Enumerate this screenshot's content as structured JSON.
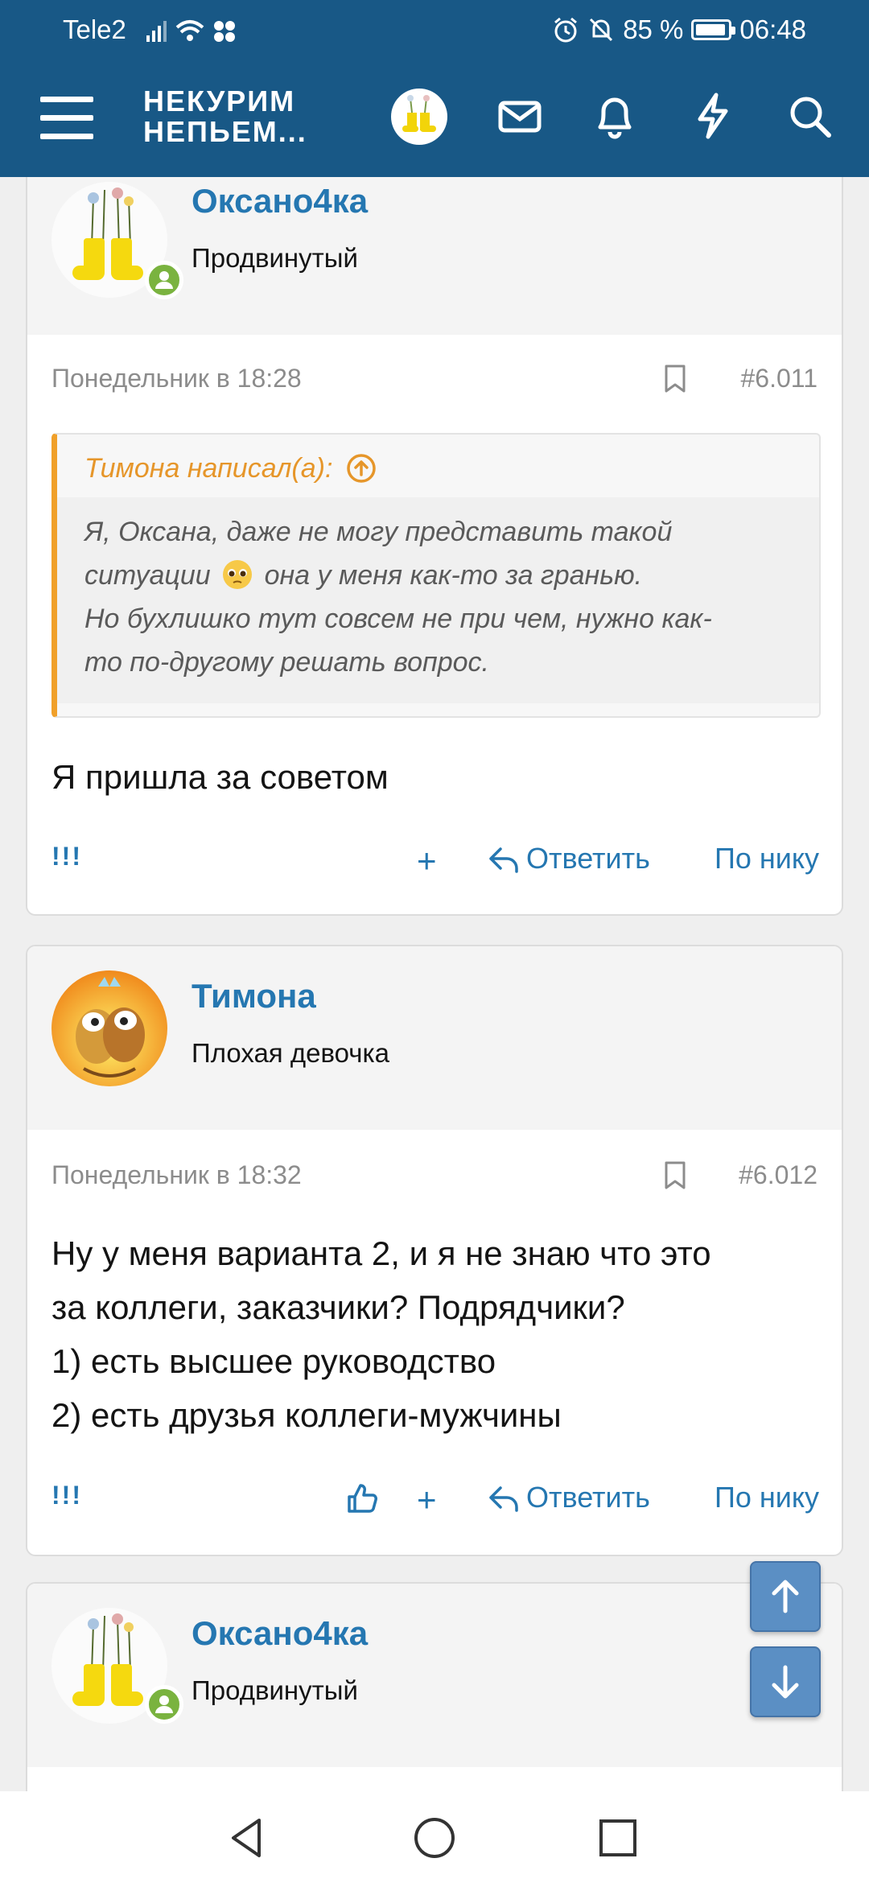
{
  "status_bar": {
    "carrier": "Tele2",
    "battery": "85 %",
    "time": "06:48"
  },
  "header": {
    "logo_line1": "НЕКУРИМ",
    "logo_line2": "НЕПЬЕМ...",
    "icons": [
      "menu-icon",
      "avatar",
      "mail-icon",
      "bell-icon",
      "lightning-icon",
      "search-icon"
    ]
  },
  "posts": [
    {
      "username": "Оксано4ка",
      "user_title": "Продвинутый",
      "date": "Понедельник в 18:28",
      "post_number": "#6.011",
      "quote": {
        "author": "Тимона написал(а):",
        "line1": "Я, Оксана, даже не могу представить такой",
        "line2_a": "ситуации",
        "line2_b": "она у меня как-то за гранью.",
        "line3": "Но бухлишко тут совсем не при чем, нужно как-",
        "line4": "то по-другому решать вопрос."
      },
      "message": [
        "Я пришла за советом"
      ],
      "actions": {
        "excl": "!!!",
        "plus": "+",
        "reply": "Ответить",
        "by_nick": "По нику"
      }
    },
    {
      "username": "Тимона",
      "user_title": "Плохая девочка",
      "date": "Понедельник в 18:32",
      "post_number": "#6.012",
      "message": [
        "Ну у меня варианта 2, и я не знаю что это",
        "за коллеги, заказчики? Подрядчики?",
        "1) есть высшее руководство",
        "2) есть друзья коллеги-мужчины"
      ],
      "actions": {
        "excl": "!!!",
        "plus": "+",
        "reply": "Ответить",
        "by_nick": "По нику"
      }
    },
    {
      "username": "Оксано4ка",
      "user_title": "Продвинутый"
    }
  ],
  "colors": {
    "header_bg": "#185886",
    "link": "#2577b1",
    "quote_accent": "#f0a02a",
    "online": "#7ab33f"
  }
}
